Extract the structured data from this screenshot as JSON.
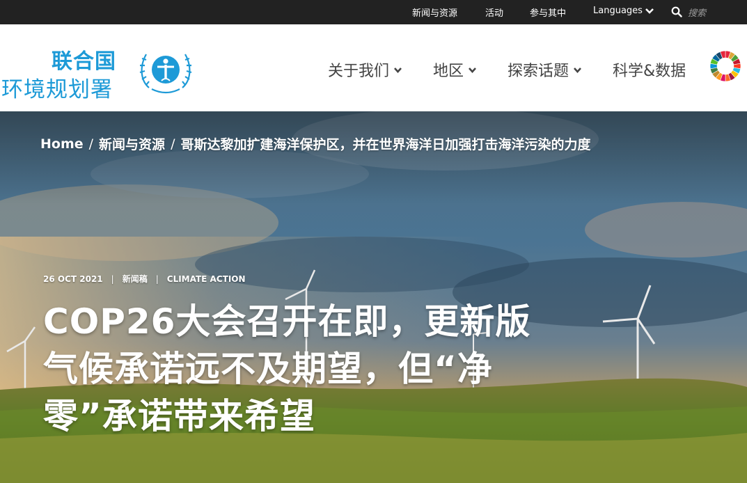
{
  "topbar": {
    "links": [
      "新闻与资源",
      "活动",
      "参与其中",
      "Languages"
    ],
    "search_placeholder": "搜索"
  },
  "header": {
    "logo_line1": "联合国",
    "logo_line2": "环境规划署",
    "nav": [
      "关于我们",
      "地区",
      "探索话题",
      "科学&数据"
    ]
  },
  "hero": {
    "breadcrumb": [
      "Home",
      "新闻与资源",
      "哥斯达黎加扩建海洋保护区，并在世界海洋日加强打击海洋污染的力度"
    ],
    "meta": {
      "date": "26 OCT 2021",
      "type": "新闻稿",
      "topic": "CLIMATE ACTION"
    },
    "headline_lines": [
      "COP26大会召开在即，更新版",
      "气候承诺远不及期望，但“净",
      "零”承诺带来希望"
    ]
  },
  "colors": {
    "topbar_bg": "#222222",
    "brand_blue": "#1d9ad7",
    "nav_text": "#444444"
  },
  "icons": [
    "chevron-down-icon",
    "search-icon",
    "unep-emblem",
    "sdg-wheel-icon"
  ]
}
